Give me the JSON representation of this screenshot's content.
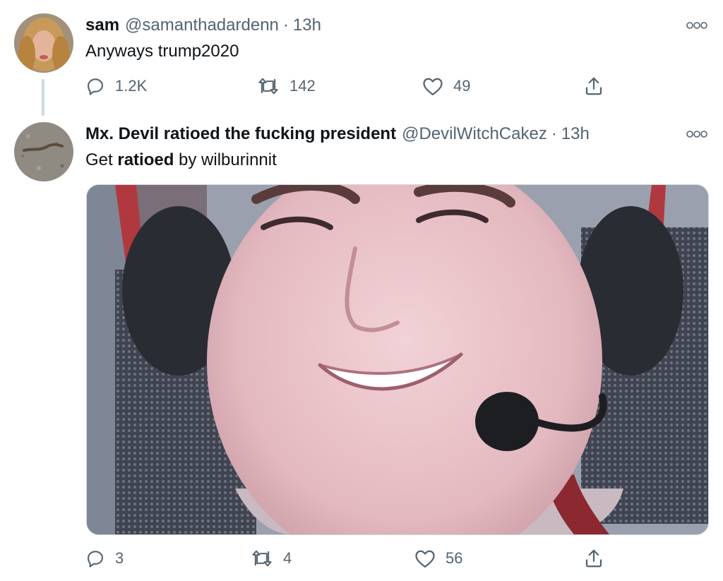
{
  "tweets": [
    {
      "display_name": "sam",
      "handle": "@samanthadardenn",
      "separator": "·",
      "time": "13h",
      "text": "Anyways trump2020",
      "reply_count": "1.2K",
      "retweet_count": "142",
      "like_count": "49"
    },
    {
      "display_name": "Mx. Devil ratioed the fucking president",
      "handle": "@DevilWitchCakez",
      "separator": "·",
      "time": "13h",
      "text_parts": [
        "Get ",
        "ratioed",
        " by wilburinnit"
      ],
      "reply_count": "3",
      "retweet_count": "4",
      "like_count": "56",
      "media": {
        "description": "photo"
      }
    }
  ],
  "icons": {
    "more": "more-icon",
    "reply": "reply-icon",
    "retweet": "retweet-icon",
    "like": "like-icon",
    "share": "share-icon"
  },
  "colors": {
    "text_primary": "#0f1419",
    "text_secondary": "#536471",
    "border": "#cfd9de"
  }
}
